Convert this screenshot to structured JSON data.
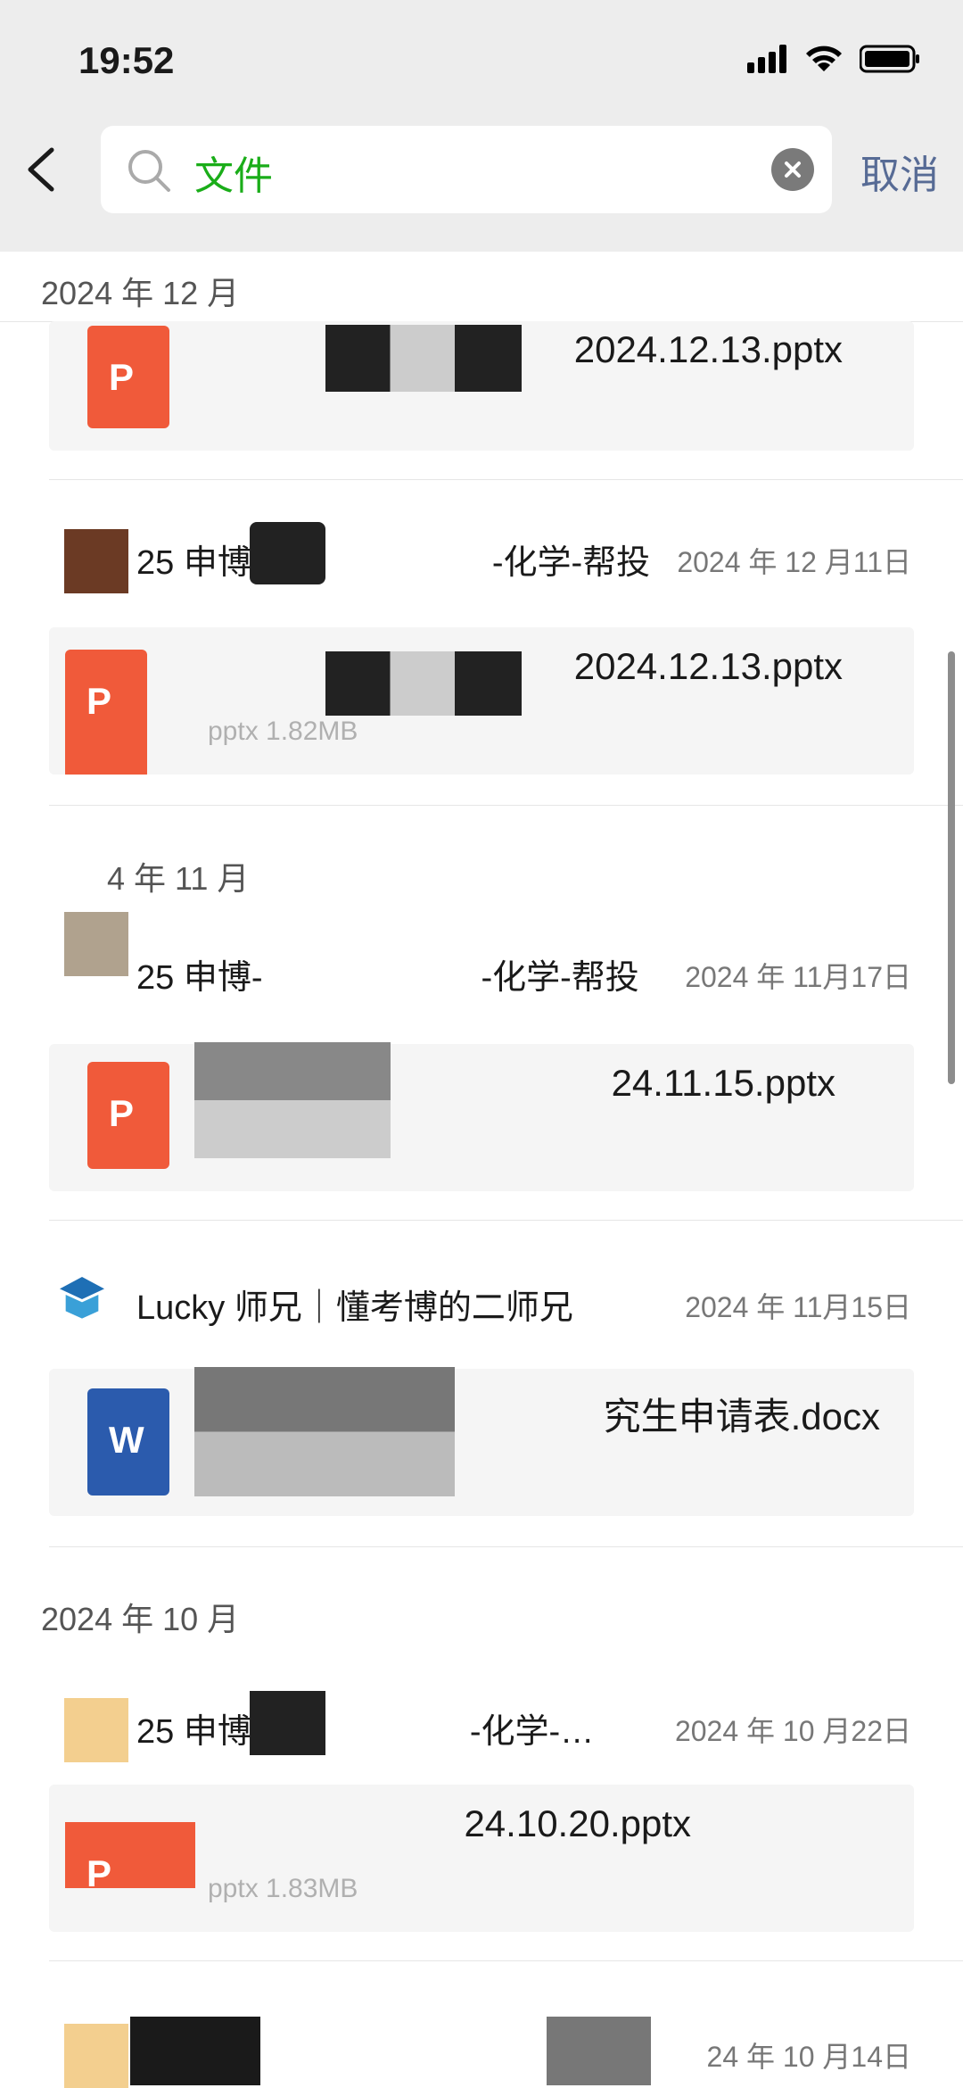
{
  "status_bar": {
    "time": "19:52"
  },
  "search": {
    "query": "文件"
  },
  "cancel_label": "取消",
  "sections": {
    "dec": "2024 年 12 月",
    "nov": "4 年 11 月",
    "oct": "2024 年 10 月"
  },
  "items": [
    {
      "file": "2024.12.13.pptx"
    },
    {
      "sender": "25 申博",
      "sender_suffix": "-化学-帮投",
      "date": "2024 年 12 月11日",
      "file": "2024.12.13.pptx",
      "meta": "pptx 1.82MB"
    },
    {
      "sender": "25 申博-",
      "sender_suffix": "-化学-帮投",
      "date": "2024 年 11月17日",
      "file": "24.11.15.pptx"
    },
    {
      "sender": "Lucky 师兄｜懂考博的二师兄",
      "date": "2024 年 11月15日",
      "file": "究生申请表.docx"
    },
    {
      "sender": "25 申博",
      "sender_suffix": "-化学-…",
      "date": "2024 年 10 月22日",
      "file": "24.10.20.pptx",
      "meta": "pptx 1.83MB"
    },
    {
      "date": "24 年 10 月14日"
    }
  ],
  "icons": {
    "ppt": "P",
    "doc": "W"
  },
  "colors": {
    "accent_green": "#1aad19",
    "link_blue": "#576b95",
    "ppt_orange": "#f05a3a",
    "word_blue": "#2b5bad"
  }
}
